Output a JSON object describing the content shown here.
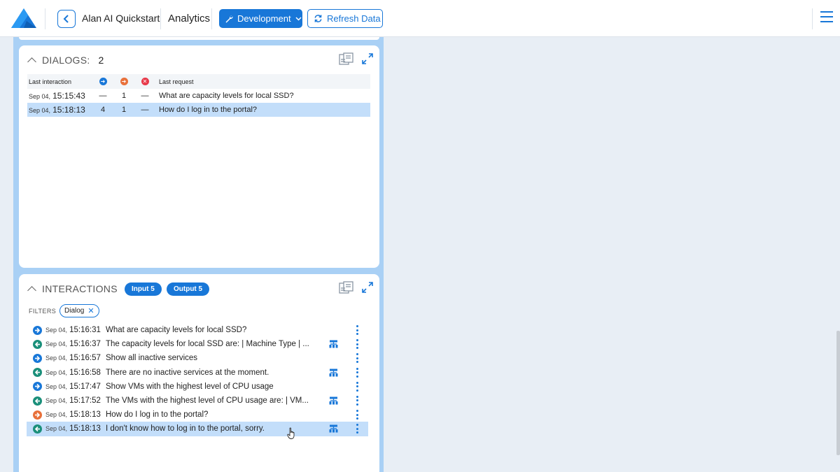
{
  "header": {
    "project_name": "Alan AI Quickstart",
    "section": "Analytics",
    "environment_button": "Development",
    "refresh_button": "Refresh Data"
  },
  "colors": {
    "accent": "#1877d8",
    "input_icon": "#1877d8",
    "output_icon": "#1a8f7a",
    "unrecognized_icon": "#e8703a",
    "error_icon": "#e83a4a",
    "column_bg": "#a9d0f5",
    "selected_row": "#c3defa"
  },
  "dialogs": {
    "title": "DIALOGS:",
    "count": "2",
    "headers": {
      "last_interaction": "Last interaction",
      "last_request": "Last request"
    },
    "rows": [
      {
        "date": "Sep 04,",
        "time": "15:15:43",
        "input": "—",
        "unrecognized": "1",
        "errors": "—",
        "request": "What are capacity levels for local SSD?",
        "selected": false
      },
      {
        "date": "Sep 04,",
        "time": "15:18:13",
        "input": "4",
        "unrecognized": "1",
        "errors": "—",
        "request": "How do I log in to the portal?",
        "selected": true
      }
    ]
  },
  "interactions": {
    "title": "INTERACTIONS",
    "input_pill": "Input 5",
    "output_pill": "Output 5",
    "filters_label": "FILTERS",
    "filter_chip": "Dialog",
    "rows": [
      {
        "kind": "input",
        "date": "Sep 04,",
        "time": "15:16:31",
        "text": "What are capacity levels for local SSD?",
        "flow": false
      },
      {
        "kind": "output",
        "date": "Sep 04,",
        "time": "15:16:37",
        "text": "The capacity levels for local SSD are: | Machine Type | ...",
        "flow": true
      },
      {
        "kind": "input",
        "date": "Sep 04,",
        "time": "15:16:57",
        "text": "Show all inactive services",
        "flow": false
      },
      {
        "kind": "output",
        "date": "Sep 04,",
        "time": "15:16:58",
        "text": "There are no inactive services at the moment.",
        "flow": true
      },
      {
        "kind": "input",
        "date": "Sep 04,",
        "time": "15:17:47",
        "text": "Show VMs with the highest level of CPU usage",
        "flow": false
      },
      {
        "kind": "output",
        "date": "Sep 04,",
        "time": "15:17:52",
        "text": "The VMs with the highest level of CPU usage are: | VM...",
        "flow": true
      },
      {
        "kind": "unrecognized",
        "date": "Sep 04,",
        "time": "15:18:13",
        "text": "How do I log in to the portal?",
        "flow": false
      },
      {
        "kind": "output",
        "date": "Sep 04,",
        "time": "15:18:13",
        "text": "I don't know how to log in to the portal, sorry.",
        "flow": true,
        "selected": true
      }
    ]
  }
}
